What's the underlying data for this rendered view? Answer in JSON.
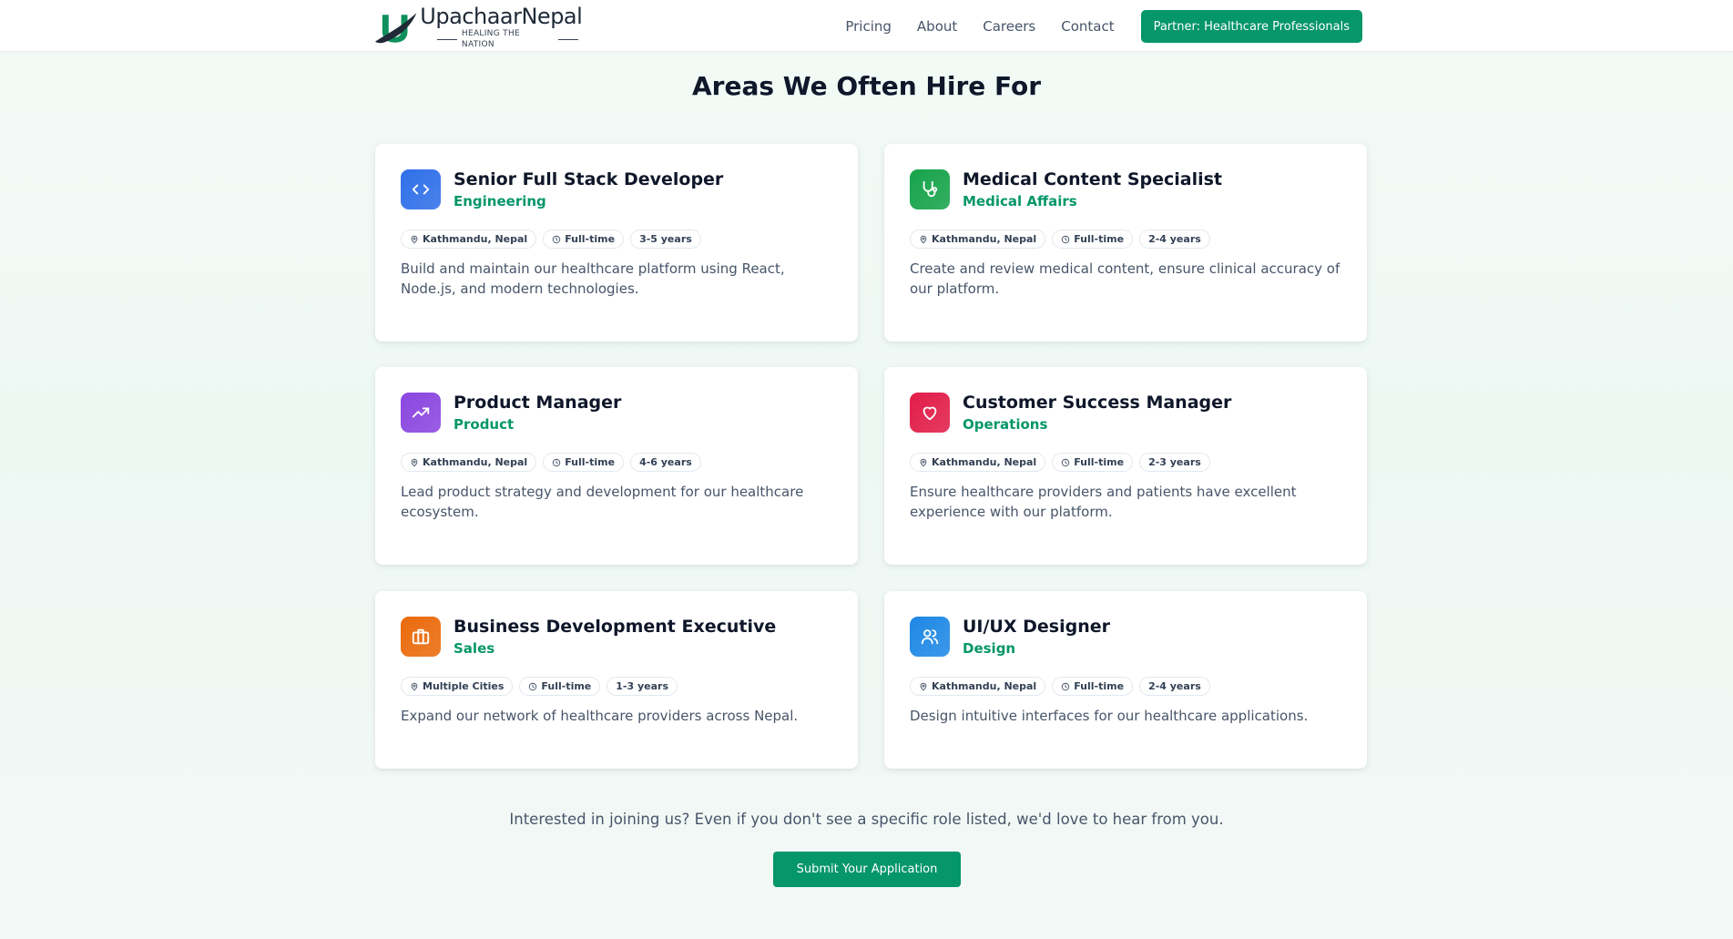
{
  "header": {
    "logo": {
      "name": "UpachaarNepal",
      "tagline": "HEALING THE NATION"
    },
    "nav": [
      "Pricing",
      "About",
      "Careers",
      "Contact"
    ],
    "partner_button": "Partner: Healthcare Professionals"
  },
  "section": {
    "title": "Areas We Often Hire For"
  },
  "roles": [
    {
      "title": "Senior Full Stack Developer",
      "department": "Engineering",
      "location": "Kathmandu, Nepal",
      "type": "Full-time",
      "experience": "3-5 years",
      "description": "Build and maintain our healthcare platform using React, Node.js, and modern technologies.",
      "icon": "code-icon",
      "icon_color": "#2f6fe8"
    },
    {
      "title": "Medical Content Specialist",
      "department": "Medical Affairs",
      "location": "Kathmandu, Nepal",
      "type": "Full-time",
      "experience": "2-4 years",
      "description": "Create and review medical content, ensure clinical accuracy of our platform.",
      "icon": "stethoscope-icon",
      "icon_color": "#16a34a"
    },
    {
      "title": "Product Manager",
      "department": "Product",
      "location": "Kathmandu, Nepal",
      "type": "Full-time",
      "experience": "4-6 years",
      "description": "Lead product strategy and development for our healthcare ecosystem.",
      "icon": "trending-up-icon",
      "icon_color": "#8b46e0"
    },
    {
      "title": "Customer Success Manager",
      "department": "Operations",
      "location": "Kathmandu, Nepal",
      "type": "Full-time",
      "experience": "2-3 years",
      "description": "Ensure healthcare providers and patients have excellent experience with our platform.",
      "icon": "heart-icon",
      "icon_color": "#e11d48"
    },
    {
      "title": "Business Development Executive",
      "department": "Sales",
      "location": "Multiple Cities",
      "type": "Full-time",
      "experience": "1-3 years",
      "description": "Expand our network of healthcare providers across Nepal.",
      "icon": "briefcase-icon",
      "icon_color": "#ea6a0c"
    },
    {
      "title": "UI/UX Designer",
      "department": "Design",
      "location": "Kathmandu, Nepal",
      "type": "Full-time",
      "experience": "2-4 years",
      "description": "Design intuitive interfaces for our healthcare applications.",
      "icon": "users-icon",
      "icon_color": "#1e88e5"
    }
  ],
  "cta": {
    "text": "Interested in joining us? Even if you don't see a specific role listed, we'd love to hear from you.",
    "button": "Submit Your Application"
  }
}
